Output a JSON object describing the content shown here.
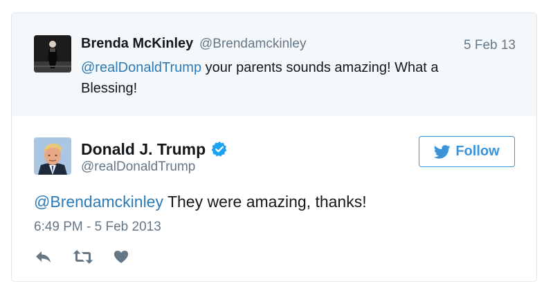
{
  "parent_tweet": {
    "author_name": "Brenda McKinley",
    "author_handle": "@Brendamckinley",
    "date": "5 Feb 13",
    "mention": "@realDonaldTrump",
    "text": " your parents sounds amazing! What a Blessing!"
  },
  "main_tweet": {
    "author_name": "Donald J. Trump",
    "author_handle": "@realDonaldTrump",
    "verified": true,
    "follow_label": "Follow",
    "mention": "@Brendamckinley",
    "text": " They were amazing, thanks!",
    "timestamp": "6:49 PM - 5 Feb 2013"
  },
  "actions": {
    "icons": [
      "reply-icon",
      "retweet-icon",
      "like-icon"
    ]
  },
  "colors": {
    "link": "#2b7bb9",
    "follow_blue": "#3b94d9",
    "secondary_text": "#657786",
    "parent_background": "#f5f8fa",
    "border": "#e1e8ed"
  }
}
